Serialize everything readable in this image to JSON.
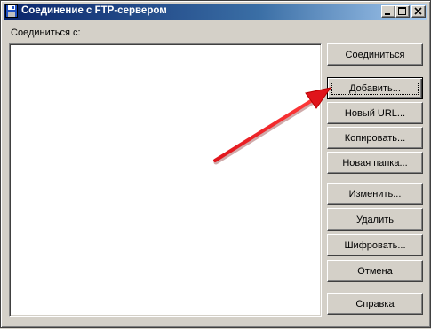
{
  "window": {
    "title": "Соединение с FTP-сервером"
  },
  "main": {
    "connect_label": "Соединиться с:"
  },
  "buttons": {
    "connect": "Соединиться",
    "add": "Добавить...",
    "new_url": "Новый URL...",
    "copy": "Копировать...",
    "new_folder": "Новая папка...",
    "edit": "Изменить...",
    "delete": "Удалить",
    "encrypt": "Шифровать...",
    "cancel": "Отмена",
    "help": "Справка"
  },
  "annotation": {
    "arrow_color": "#e0141b"
  },
  "colors": {
    "title_start": "#0a246a",
    "title_end": "#a6caf0",
    "face": "#d4d0c8"
  }
}
